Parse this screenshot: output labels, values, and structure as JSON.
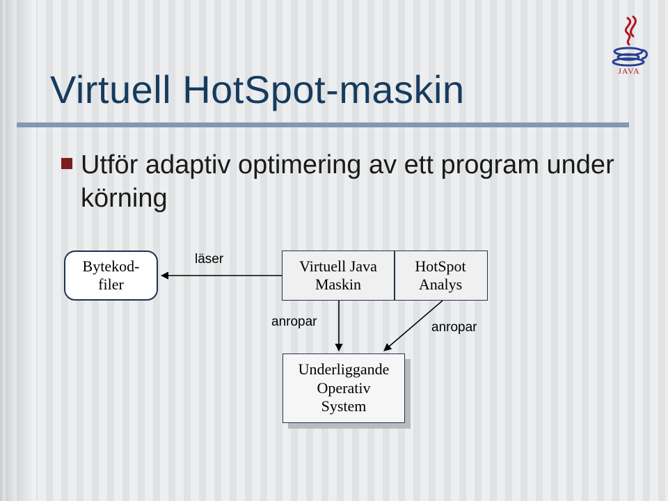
{
  "title": "Virtuell HotSpot-maskin",
  "bullet": "Utför adaptiv optimering av ett program under körning",
  "logo_caption": "JAVA",
  "diagram": {
    "nodes": {
      "bytecode_files": "Bytekod-\nfiler",
      "jvm": "Virtuell Java\nMaskin",
      "hotspot": "HotSpot\nAnalys",
      "os": "Underliggande\nOperativ\nSystem"
    },
    "edges": {
      "reads": "läser",
      "calls_left": "anropar",
      "calls_right": "anropar"
    }
  },
  "chart_data": {
    "type": "diagram",
    "title": "Virtuell HotSpot-maskin",
    "nodes": [
      {
        "id": "bytecode_files",
        "label": "Bytekod-filer"
      },
      {
        "id": "jvm",
        "label": "Virtuell Java Maskin"
      },
      {
        "id": "hotspot",
        "label": "HotSpot Analys"
      },
      {
        "id": "os",
        "label": "Underliggande Operativ System"
      }
    ],
    "edges": [
      {
        "from": "jvm",
        "to": "bytecode_files",
        "label": "läser"
      },
      {
        "from": "jvm",
        "to": "os",
        "label": "anropar"
      },
      {
        "from": "hotspot",
        "to": "os",
        "label": "anropar"
      }
    ]
  }
}
